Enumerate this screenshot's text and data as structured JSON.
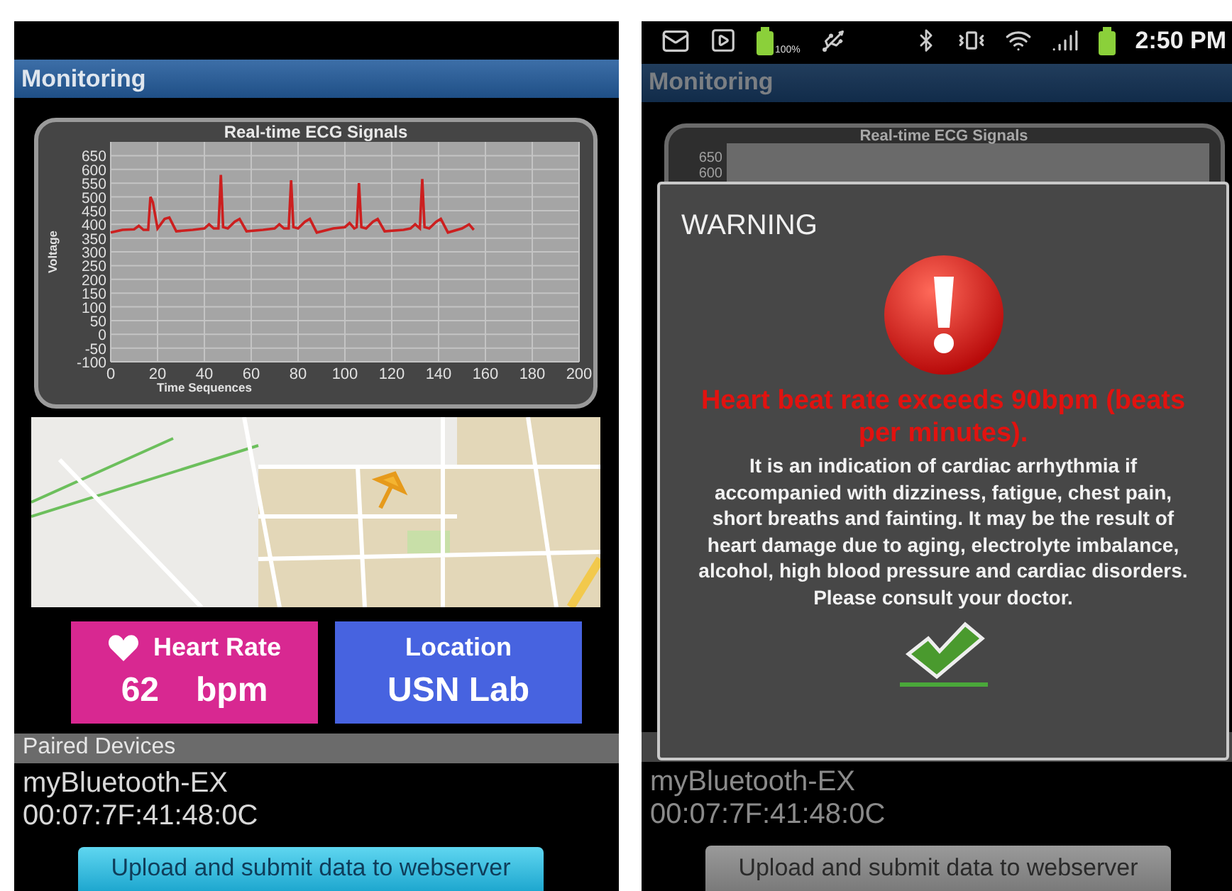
{
  "left_screen": {
    "dimmed": false,
    "title": "Monitoring",
    "chart": {
      "chart_data": {
        "type": "line",
        "title": "Real-time ECG Signals",
        "xlabel": "Time Sequences",
        "ylabel": "Voltage",
        "x": [
          0,
          5,
          10,
          12,
          14,
          16,
          17,
          18,
          20,
          23,
          25,
          28,
          35,
          40,
          42,
          44,
          46,
          47,
          48,
          50,
          53,
          55,
          58,
          65,
          70,
          72,
          74,
          76,
          77,
          78,
          80,
          83,
          85,
          88,
          95,
          100,
          102,
          104,
          105,
          106,
          107,
          109,
          112,
          114,
          117,
          125,
          128,
          130,
          132,
          133,
          134,
          136,
          139,
          141,
          144,
          150,
          153,
          155
        ],
        "series": [
          {
            "color": "#cc1f1f",
            "values": [
              370,
              380,
              382,
              395,
              380,
              380,
              500,
              480,
              385,
              420,
              425,
              375,
              380,
              385,
              400,
              385,
              385,
              580,
              390,
              385,
              410,
              420,
              375,
              380,
              385,
              400,
              385,
              385,
              560,
              390,
              385,
              410,
              420,
              370,
              385,
              390,
              405,
              385,
              390,
              550,
              390,
              385,
              410,
              420,
              375,
              380,
              385,
              400,
              385,
              565,
              390,
              385,
              410,
              420,
              370,
              385,
              400,
              380
            ]
          }
        ],
        "grid": true,
        "xlim": [
          0,
          200
        ],
        "ylim": [
          -100,
          700
        ],
        "xticks": [
          0,
          20,
          40,
          60,
          80,
          100,
          120,
          140,
          160,
          180,
          200
        ],
        "yticks": [
          -100,
          -50,
          0,
          50,
          100,
          150,
          200,
          250,
          300,
          350,
          400,
          450,
          500,
          550,
          600,
          650
        ]
      }
    },
    "cards": [
      {
        "kind": "heart",
        "label": "Heart Rate",
        "value": "62",
        "unit": "bpm",
        "color": "#d82891"
      },
      {
        "kind": "location",
        "label": "Location",
        "value": "USN Lab",
        "color": "#4763e0"
      }
    ],
    "paired_devices": {
      "header": "Paired Devices",
      "name": "myBluetooth-EX",
      "address": "00:07:7F:41:48:0C"
    },
    "upload_button": "Upload and submit data to webserver"
  },
  "right_screen": {
    "dimmed": true,
    "status_bar": {
      "battery_label": "100%",
      "time": "2:50 PM"
    },
    "title": "Monitoring",
    "chart_title": "Real-time ECG Signals",
    "chart_ticks": [
      "650",
      "600"
    ],
    "paired_devices": {
      "name": "myBluetooth-EX",
      "address": "00:07:7F:41:48:0C"
    },
    "upload_button": "Upload and submit data to webserver",
    "dialog": {
      "title": "WARNING",
      "alert": "Heart beat rate exceeds 90bpm (beats per minutes).",
      "message": "It is an indication of cardiac arrhythmia if accompanied with dizziness, fatigue, chest pain, short breaths and fainting. It may be the result of heart damage due to aging, electrolyte imbalance, alcohol, high blood pressure and cardiac disorders. Please consult your doctor."
    }
  }
}
